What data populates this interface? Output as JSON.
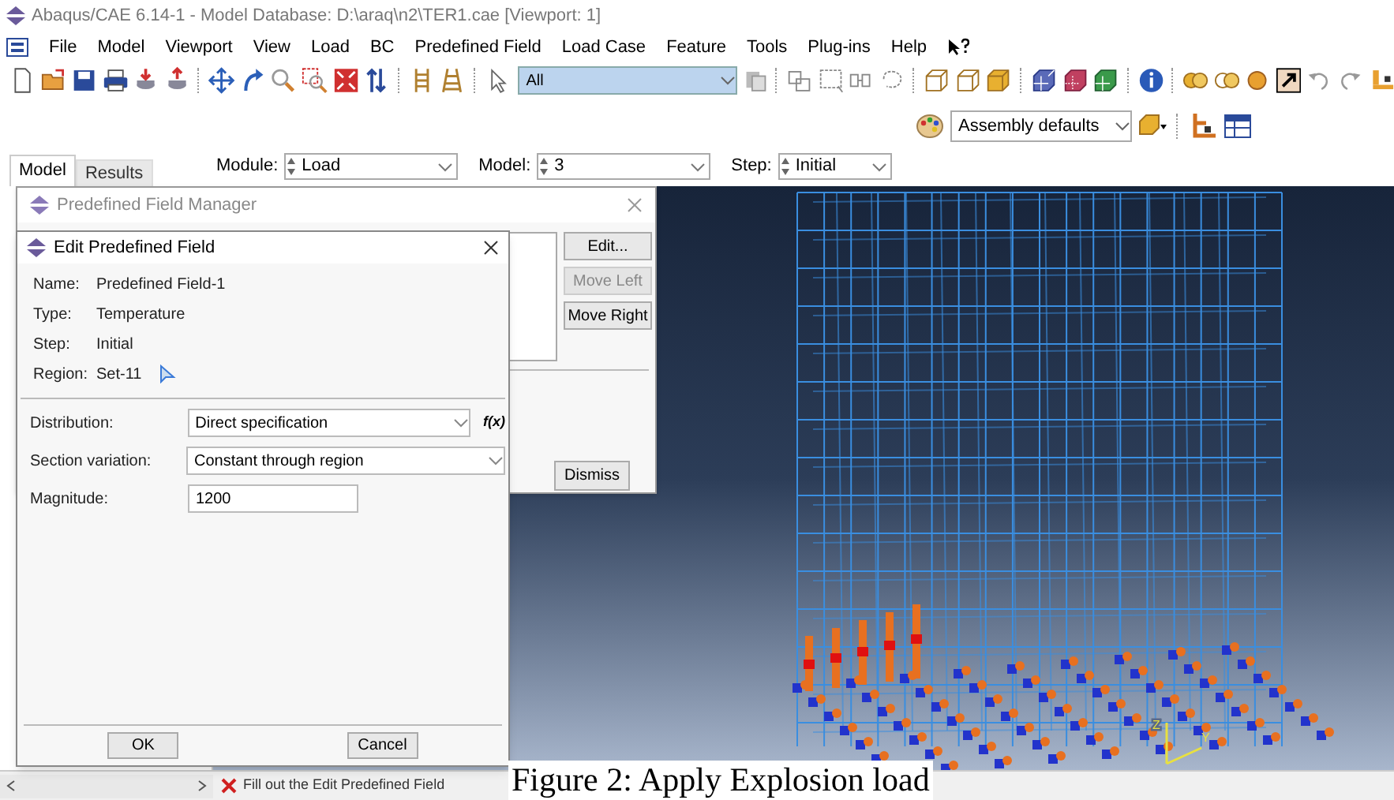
{
  "window": {
    "title": "Abaqus/CAE 6.14-1 - Model Database: D:\\araq\\n2\\TER1.cae [Viewport: 1]"
  },
  "menu": [
    {
      "label": "File"
    },
    {
      "label": "Model"
    },
    {
      "label": "Viewport"
    },
    {
      "label": "View"
    },
    {
      "label": "Load"
    },
    {
      "label": "BC"
    },
    {
      "label": "Predefined Field"
    },
    {
      "label": "Load Case"
    },
    {
      "label": "Feature"
    },
    {
      "label": "Tools"
    },
    {
      "label": "Plug-ins"
    },
    {
      "label": "Help"
    }
  ],
  "toolbar": {
    "selection_filter": "All",
    "render_style": "Assembly defaults"
  },
  "tabs": [
    {
      "label": "Model",
      "selected": true
    },
    {
      "label": "Results",
      "selected": false
    }
  ],
  "context": [
    {
      "label": "Module:",
      "value": "Load"
    },
    {
      "label": "Model:",
      "value": "3"
    },
    {
      "label": "Step:",
      "value": "Initial"
    }
  ],
  "manager": {
    "title": "Predefined Field Manager",
    "buttons": [
      {
        "label": "Edit...",
        "disabled": false
      },
      {
        "label": "Move Left",
        "disabled": true
      },
      {
        "label": "Move Right",
        "disabled": false
      }
    ],
    "dismiss": "Dismiss"
  },
  "editor": {
    "title": "Edit Predefined Field",
    "info": [
      {
        "label": "Name:",
        "value": "Predefined Field-1"
      },
      {
        "label": "Type:",
        "value": "Temperature"
      },
      {
        "label": "Step:",
        "value": "Initial"
      },
      {
        "label": "Region:",
        "value": "Set-11"
      }
    ],
    "fields": [
      {
        "kind": "dropdown",
        "label": "Distribution:",
        "value": "Direct specification",
        "extra": "f(x)"
      },
      {
        "kind": "dropdown",
        "label": "Section variation:",
        "value": "Constant through region"
      },
      {
        "kind": "text",
        "label": "Magnitude:",
        "value": "1200"
      }
    ],
    "buttons": [
      "OK",
      "Cancel"
    ]
  },
  "status": {
    "message": "Fill out the Edit Predefined Field"
  },
  "viewport": {
    "triad_labels": [
      "Z",
      "Y"
    ]
  },
  "caption": "Figure 2: Apply Explosion load"
}
